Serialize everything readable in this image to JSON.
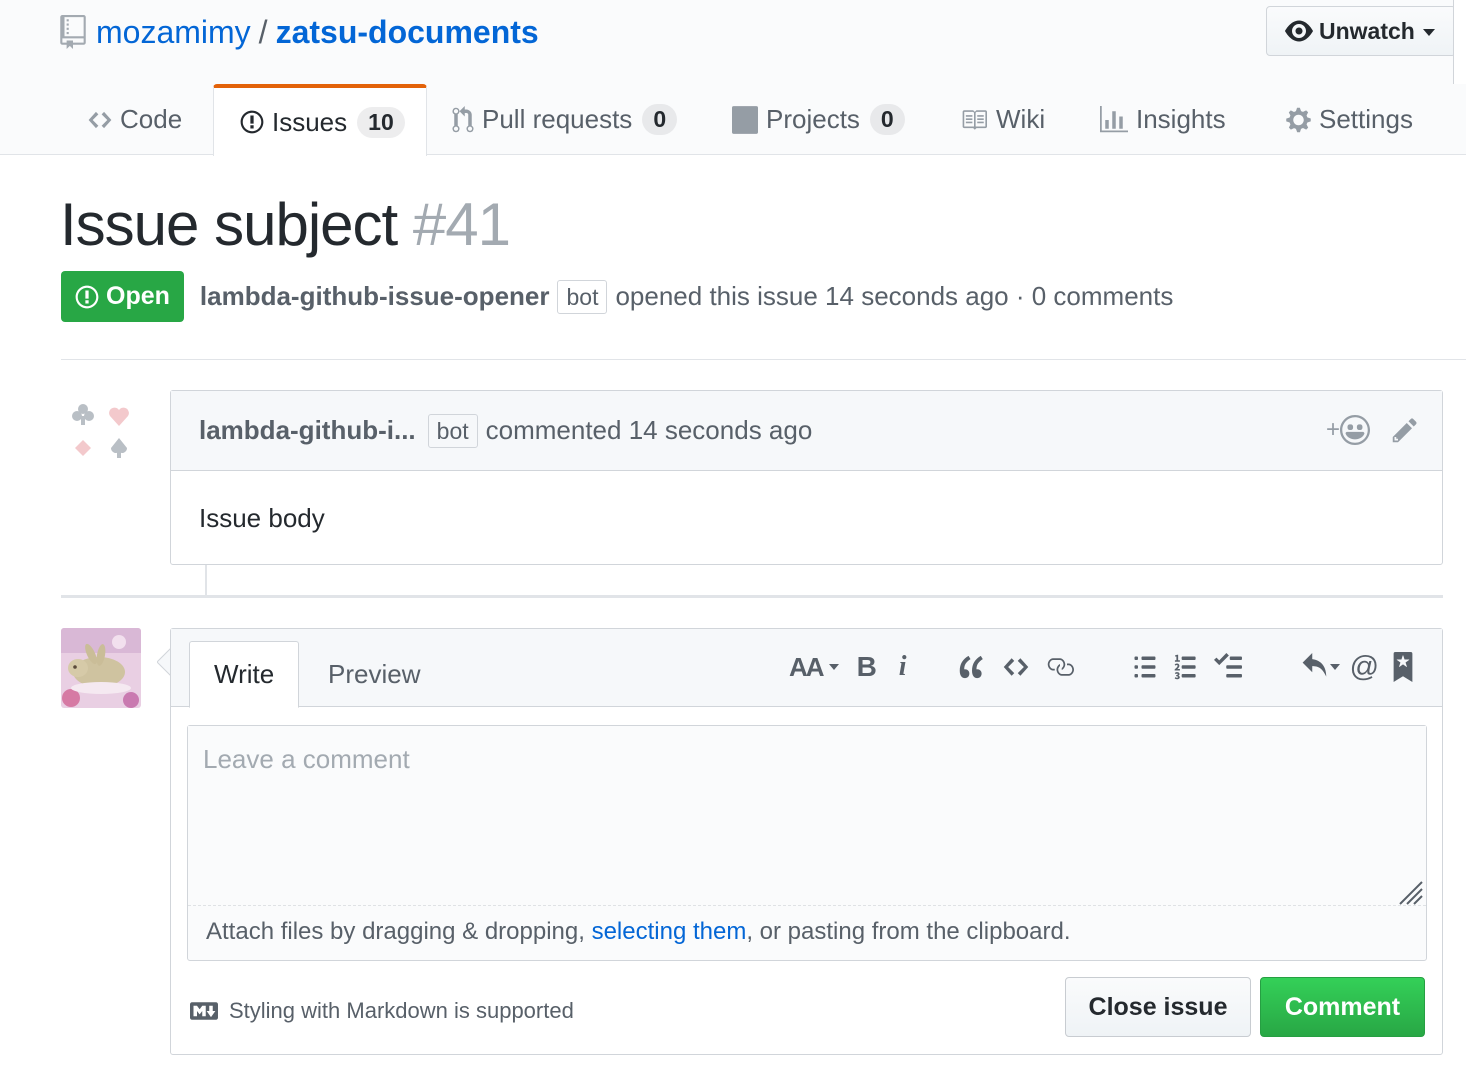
{
  "repo": {
    "owner": "mozamimy",
    "separator": "/",
    "name": "zatsu-documents",
    "icon": "repo-icon"
  },
  "watch": {
    "label": "Unwatch",
    "icon": "eye-icon"
  },
  "tabs": [
    {
      "label": "Code",
      "icon": "code-icon",
      "selected": false
    },
    {
      "label": "Issues",
      "icon": "issue-opened-icon",
      "count": "10",
      "selected": true
    },
    {
      "label": "Pull requests",
      "icon": "git-pull-request-icon",
      "count": "0",
      "selected": false
    },
    {
      "label": "Projects",
      "icon": "project-icon",
      "count": "0",
      "selected": false
    },
    {
      "label": "Wiki",
      "icon": "book-icon",
      "selected": false
    },
    {
      "label": "Insights",
      "icon": "graph-icon",
      "selected": false
    },
    {
      "label": "Settings",
      "icon": "gear-icon",
      "selected": false
    }
  ],
  "issue": {
    "title": "Issue subject",
    "number": "#41",
    "state": "Open",
    "author": "lambda-github-issue-opener",
    "author_badge": "bot",
    "meta_text": "opened this issue 14 seconds ago · 0 comments"
  },
  "comment": {
    "author": "lambda-github-i...",
    "author_badge": "bot",
    "meta": "commented 14 seconds ago",
    "body": "Issue body",
    "reaction_plus": "+"
  },
  "new_comment": {
    "tabs": [
      "Write",
      "Preview"
    ],
    "placeholder": "Leave a comment",
    "attach_prefix": "Attach files by dragging & dropping, ",
    "attach_link": "selecting them",
    "attach_suffix": ", or pasting from the clipboard.",
    "markdown_hint": "Styling with Markdown is supported",
    "toolbar": {
      "header": "AA",
      "bold": "B",
      "italic": "i",
      "mention": "@"
    },
    "close_button": "Close issue",
    "comment_button": "Comment"
  },
  "colors": {
    "accent_link": "#0366d6",
    "open_green": "#28a745",
    "selected_tab_border": "#e36209"
  }
}
